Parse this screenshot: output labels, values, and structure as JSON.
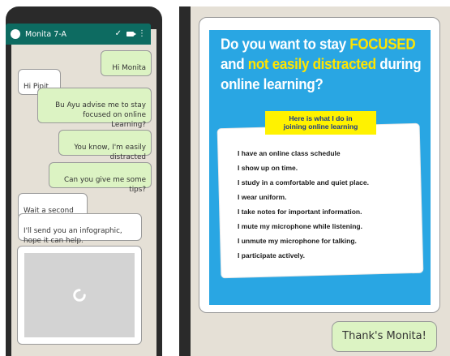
{
  "left_chat": {
    "contact_name": "Monita 7-A",
    "messages": [
      {
        "direction": "out",
        "text": "Hi Monita"
      },
      {
        "direction": "in",
        "text": "Hi Pipit"
      },
      {
        "direction": "out",
        "text": "Bu Ayu advise me to stay\nfocused on online\nLearning?"
      },
      {
        "direction": "out",
        "text": "You know, I'm easily\ndistracted"
      },
      {
        "direction": "out",
        "text": "Can you give me some\ntips?"
      },
      {
        "direction": "in",
        "text": "Wait a second"
      },
      {
        "direction": "in",
        "text": "I'll send you an infographic,\nhope it can help."
      }
    ]
  },
  "infographic": {
    "title_part1": "Do you want to stay ",
    "title_focus": "FOCUSED",
    "title_part2": "and ",
    "title_not_distracted": "not easily distracted",
    "title_part3": " during online learning?",
    "list_heading": "Here is what I do in\njoining online learning",
    "items": [
      "I have an online class schedule",
      "I show up on time.",
      "I study in a comfortable and quiet place.",
      "I wear uniform.",
      "I take notes for important information.",
      "I mute my microphone while listening.",
      "I unmute my microphone for talking.",
      "I participate actively."
    ]
  },
  "reply": {
    "text": "Thank's Monita!"
  }
}
